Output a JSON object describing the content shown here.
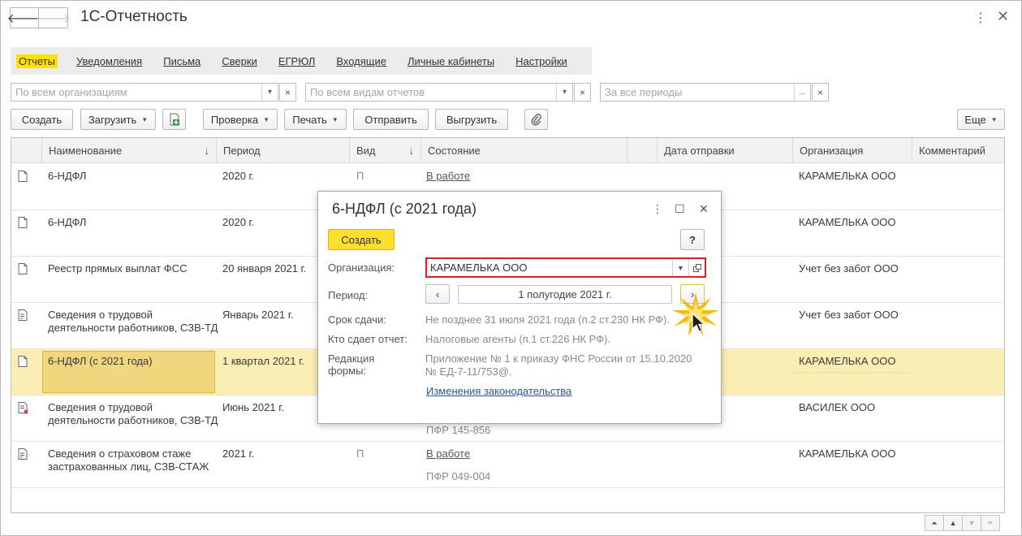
{
  "window": {
    "title": "1С-Отчетность",
    "back_glyph": "🡐",
    "forward_glyph": "🡒",
    "more_glyph": "⋮",
    "close_glyph": "✕"
  },
  "tabs": [
    {
      "label": "Отчеты",
      "active": true
    },
    {
      "label": "Уведомления"
    },
    {
      "label": "Письма"
    },
    {
      "label": "Сверки"
    },
    {
      "label": "ЕГРЮЛ"
    },
    {
      "label": "Входящие"
    },
    {
      "label": "Личные кабинеты"
    },
    {
      "label": "Настройки"
    }
  ],
  "filters": {
    "organization_placeholder": "По всем организациям",
    "report_type_placeholder": "По всем видам отчетов",
    "period_placeholder": "За все периоды",
    "dropdown_glyph": "▾",
    "clear_glyph": "×",
    "ellipsis": "..."
  },
  "toolbar": {
    "create": "Создать",
    "load": "Загрузить",
    "check": "Проверка",
    "print": "Печать",
    "send": "Отправить",
    "export": "Выгрузить",
    "more": "Еще"
  },
  "table": {
    "columns": {
      "name": "Наименование",
      "period": "Период",
      "type": "Вид",
      "status": "Состояние",
      "sent_date": "Дата отправки",
      "organization": "Организация",
      "comment": "Комментарий",
      "sort_glyph": "↓"
    },
    "rows": [
      {
        "name": "6-НДФЛ",
        "period": "2020 г.",
        "type": "П",
        "status": "В работе",
        "status2": "",
        "organization": "КАРАМЕЛЬКА ООО"
      },
      {
        "name": "6-НДФЛ",
        "period": "2020 г.",
        "type": "",
        "status": "",
        "status2": "",
        "organization": "КАРАМЕЛЬКА ООО"
      },
      {
        "name": "Реестр прямых выплат ФСС",
        "period": "20 января 2021 г.",
        "type": "",
        "status": "",
        "status2": "",
        "organization": "Учет без забот ООО"
      },
      {
        "name": "Сведения о трудовой деятельности работников, СЗВ-ТД",
        "period": "Январь 2021 г.",
        "type": "",
        "status": "",
        "status2": "",
        "organization": "Учет без забот ООО"
      },
      {
        "name": "6-НДФЛ (с 2021 года)",
        "period": "1 квартал 2021 г.",
        "type": "",
        "status": "",
        "status2": "",
        "organization": "КАРАМЕЛЬКА ООО"
      },
      {
        "name": "Сведения о трудовой деятельности работников, СЗВ-ТД",
        "period": "Июнь 2021 г.",
        "type": "",
        "status": "",
        "status2": "ПФР 145-856",
        "organization": "ВАСИЛЕК ООО"
      },
      {
        "name": "Сведения о страховом стаже застрахованных лиц, СЗВ-СТАЖ",
        "period": "2021 г.",
        "type": "П",
        "status": "В работе",
        "status2": "ПФР 049-004",
        "organization": "КАРАМЕЛЬКА ООО"
      }
    ]
  },
  "pager": {
    "first": "⏶",
    "up": "▲",
    "down": "▼",
    "last": "⏷"
  },
  "dialog": {
    "title": "6-НДФЛ (с 2021 года)",
    "more_glyph": "⋮",
    "maximize_glyph": "☐",
    "close_glyph": "✕",
    "create_button": "Создать",
    "help_button": "?",
    "organization_label": "Организация:",
    "organization_value": "КАРАМЕЛЬКА ООО",
    "period_label": "Период:",
    "period_value": "1 полугодие 2021 г.",
    "prev_glyph": "‹",
    "next_glyph": "›",
    "deadline_label": "Срок сдачи:",
    "deadline_value": "Не позднее 31 июля 2021 года (п.2 ст.230 НК РФ).",
    "submitter_label": "Кто сдает отчет:",
    "submitter_value": "Налоговые агенты (п.1 ст.226 НК РФ).",
    "edition_label": "Редакция формы:",
    "edition_value": "Приложение № 1 к приказу ФНС России от 15.10.2020 № ЕД-7-11/753@.",
    "law_link": "Изменения законодательства"
  }
}
